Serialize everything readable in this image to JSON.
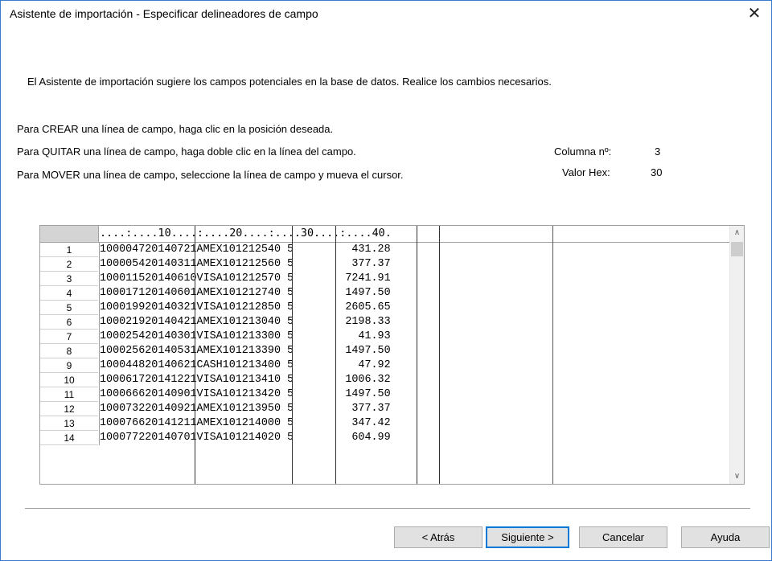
{
  "window": {
    "title": "Asistente de importación - Especificar delineadores de campo",
    "close_glyph": "✕"
  },
  "intro": "El Asistente de importación sugiere los campos potenciales en la base de datos. Realice los cambios necesarios.",
  "instructions": {
    "create": "Para CREAR una línea de campo, haga clic en la posición deseada.",
    "remove": "Para QUITAR una línea de campo, haga doble clic en la línea del campo.",
    "move": "Para MOVER una línea de campo, seleccione la línea de campo y mueva el cursor."
  },
  "info": {
    "column_label": "Columna nº:",
    "column_value": "3",
    "hex_label": "Valor Hex:",
    "hex_value": "30"
  },
  "grid": {
    "ruler": "....:....10....:....20....:....30....:....40.",
    "rows": [
      {
        "num": "1",
        "text": "100004720140721AMEX101212540 5         431.28"
      },
      {
        "num": "2",
        "text": "100005420140311AMEX101212560 5         377.37"
      },
      {
        "num": "3",
        "text": "100011520140610VISA101212570 5        7241.91"
      },
      {
        "num": "4",
        "text": "100017120140601AMEX101212740 5        1497.50"
      },
      {
        "num": "5",
        "text": "100019920140321VISA101212850 5        2605.65"
      },
      {
        "num": "6",
        "text": "100021920140421AMEX101213040 5        2198.33"
      },
      {
        "num": "7",
        "text": "100025420140301VISA101213300 5          41.93"
      },
      {
        "num": "8",
        "text": "100025620140531AMEX101213390 5        1497.50"
      },
      {
        "num": "9",
        "text": "100044820140621CASH101213400 5          47.92"
      },
      {
        "num": "10",
        "text": "100061720141221VISA101213410 5        1006.32"
      },
      {
        "num": "11",
        "text": "100066620140901VISA101213420 5        1497.50"
      },
      {
        "num": "12",
        "text": "100073220140921AMEX101213950 5         377.37"
      },
      {
        "num": "13",
        "text": "100076620141211AMEX101214000 5         347.42"
      },
      {
        "num": "14",
        "text": "100077220140701VISA101214020 5         604.99"
      }
    ]
  },
  "buttons": {
    "back": "< Atrás",
    "next": "Siguiente >",
    "cancel": "Cancelar",
    "help": "Ayuda"
  },
  "scroll": {
    "up_glyph": "∧",
    "down_glyph": "∨"
  }
}
